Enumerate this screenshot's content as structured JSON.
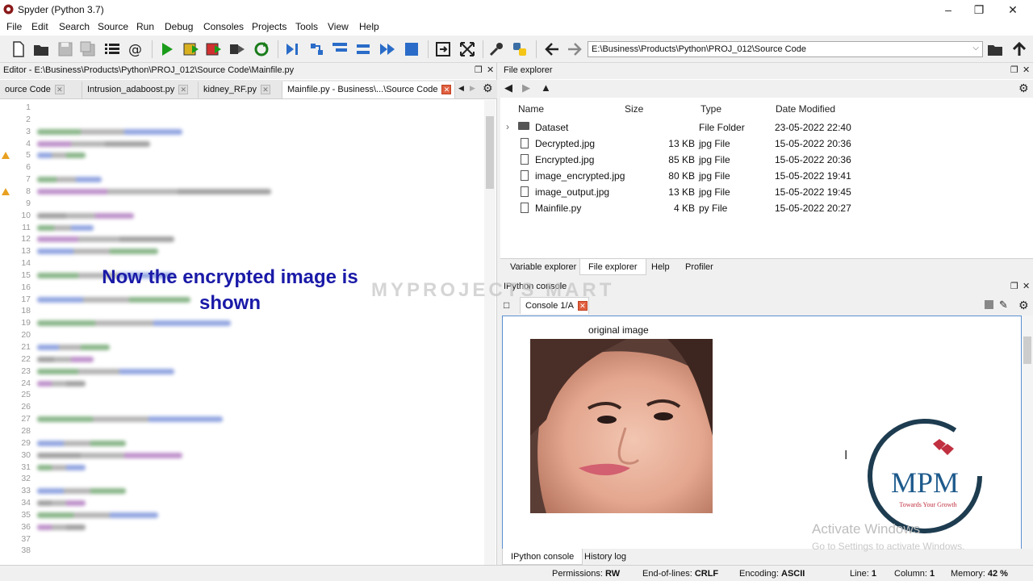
{
  "window": {
    "title": "Spyder (Python 3.7)"
  },
  "menu": [
    "File",
    "Edit",
    "Search",
    "Source",
    "Run",
    "Debug",
    "Consoles",
    "Projects",
    "Tools",
    "View",
    "Help"
  ],
  "toolbar": {
    "path": "E:\\Business\\Products\\Python\\PROJ_012\\Source Code"
  },
  "editor": {
    "header": "Editor - E:\\Business\\Products\\Python\\PROJ_012\\Source Code\\Mainfile.py",
    "tabs": [
      {
        "label": "ource Code"
      },
      {
        "label": "Intrusion_adaboost.py"
      },
      {
        "label": "kidney_RF.py"
      },
      {
        "label": "Mainfile.py - Business\\...\\Source Code"
      }
    ],
    "line_numbers": [
      "1",
      "2",
      "3",
      "4",
      "5",
      "6",
      "7",
      "8",
      "9",
      "10",
      "11",
      "12",
      "13",
      "14",
      "15",
      "16",
      "17",
      "18",
      "19",
      "20",
      "21",
      "22",
      "23",
      "24",
      "25",
      "26",
      "27",
      "28",
      "29",
      "30",
      "31",
      "32",
      "33",
      "34",
      "35",
      "36",
      "37",
      "38"
    ],
    "overlay_caption_line1": "Now the encrypted image is",
    "overlay_caption_line2": "shown"
  },
  "file_explorer": {
    "header": "File explorer",
    "columns": {
      "name": "Name",
      "size": "Size",
      "type": "Type",
      "date": "Date Modified"
    },
    "rows": [
      {
        "name": "Dataset",
        "size": "",
        "type": "File Folder",
        "date": "23-05-2022 22:40",
        "kind": "folder"
      },
      {
        "name": "Decrypted.jpg",
        "size": "13 KB",
        "type": "jpg File",
        "date": "15-05-2022 20:36",
        "kind": "file"
      },
      {
        "name": "Encrypted.jpg",
        "size": "85 KB",
        "type": "jpg File",
        "date": "15-05-2022 20:36",
        "kind": "file"
      },
      {
        "name": "image_encrypted.jpg",
        "size": "80 KB",
        "type": "jpg File",
        "date": "15-05-2022 19:41",
        "kind": "file"
      },
      {
        "name": "image_output.jpg",
        "size": "13 KB",
        "type": "jpg File",
        "date": "15-05-2022 19:45",
        "kind": "file"
      },
      {
        "name": "Mainfile.py",
        "size": "4 KB",
        "type": "py File",
        "date": "15-05-2022 20:27",
        "kind": "file"
      }
    ],
    "bottom_tabs": [
      "Variable explorer",
      "File explorer",
      "Help",
      "Profiler"
    ]
  },
  "console": {
    "header": "IPython console",
    "tab_label": "Console 1/A",
    "plot_title": "original image",
    "bottom_tabs": [
      "IPython console",
      "History log"
    ]
  },
  "watermarks": {
    "center": "MYPROJECTS MART",
    "logo_text": "MPM",
    "logo_tagline": "Towards Your Growth",
    "activate_title": "Activate Windows",
    "activate_sub": "Go to Settings to activate Windows."
  },
  "status": {
    "permissions_label": "Permissions:",
    "permissions": "RW",
    "eol_label": "End-of-lines:",
    "eol": "CRLF",
    "encoding_label": "Encoding:",
    "encoding": "ASCII",
    "line_label": "Line:",
    "line": "1",
    "column_label": "Column:",
    "column": "1",
    "memory_label": "Memory:",
    "memory": "42 %"
  },
  "colors": {
    "caption": "#1a1aa8",
    "logo_ring": "#1e3c50",
    "logo_text": "#1e5a8c",
    "accent_red": "#c03040"
  }
}
